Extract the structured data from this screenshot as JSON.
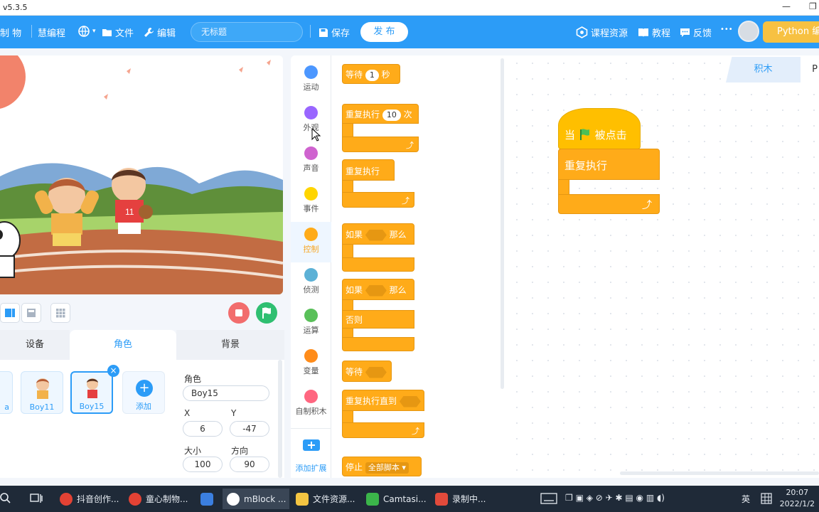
{
  "window": {
    "version": "v5.3.5",
    "minimize": "—",
    "restore": "❐"
  },
  "menubar": {
    "logo_text": "制 物",
    "brand": "慧编程",
    "file": "文件",
    "edit": "编辑",
    "project_title_placeholder": "无标题",
    "save": "保存",
    "publish": "发 布",
    "course_resources": "课程资源",
    "tutorial": "教程",
    "feedback": "反馈",
    "more": "•••",
    "python_mode": "Python 编"
  },
  "stage_toolbar": {
    "stop_color": "#f26d6d",
    "go_color": "#2fbf71"
  },
  "tabs": {
    "devices": "设备",
    "sprites": "角色",
    "backdrop": "背景"
  },
  "sprite_list": {
    "items": [
      {
        "name": "a"
      },
      {
        "name": "Boy11"
      },
      {
        "name": "Boy15"
      }
    ],
    "add_label": "添加",
    "delete_icon": "×"
  },
  "sprite_props": {
    "name_label": "角色",
    "name_value": "Boy15",
    "x_label": "X",
    "x_value": "6",
    "y_label": "Y",
    "y_value": "-47",
    "size_label": "大小",
    "size_value": "100",
    "direction_label": "方向",
    "direction_value": "90"
  },
  "categories": [
    {
      "label": "运动",
      "color": "#4c97ff"
    },
    {
      "label": "外观",
      "color": "#9966ff"
    },
    {
      "label": "声音",
      "color": "#cf63cf"
    },
    {
      "label": "事件",
      "color": "#ffd500"
    },
    {
      "label": "控制",
      "color": "#ffab19"
    },
    {
      "label": "侦测",
      "color": "#5cb1d6"
    },
    {
      "label": "运算",
      "color": "#59c059"
    },
    {
      "label": "变量",
      "color": "#ff8c1a"
    },
    {
      "label": "自制积木",
      "color": "#ff6680"
    }
  ],
  "add_extension": "添加扩展",
  "palette": {
    "wait": "等待",
    "wait_value": "1",
    "wait_unit": "秒",
    "repeat": "重复执行",
    "repeat_value": "10",
    "repeat_unit": "次",
    "forever": "重复执行",
    "if": "如果",
    "then": "那么",
    "if2": "如果",
    "then2": "那么",
    "else": "否则",
    "wait_until": "等待",
    "repeat_until": "重复执行直到",
    "stop": "停止",
    "stop_option": "全部脚本 ▾"
  },
  "workspace": {
    "tab_blocks": "积木",
    "tab_python": "P",
    "hat_when": "当",
    "hat_clicked": "被点击",
    "forever": "重复执行"
  },
  "taskbar": {
    "items": [
      {
        "label": "抖音创作..."
      },
      {
        "label": "童心制物..."
      },
      {
        "label": "mBlock ..."
      },
      {
        "label": "文件资源..."
      },
      {
        "label": "Camtasi..."
      },
      {
        "label": "录制中..."
      }
    ],
    "ime": "英",
    "time": "20:07",
    "date": "2022/1/2"
  }
}
